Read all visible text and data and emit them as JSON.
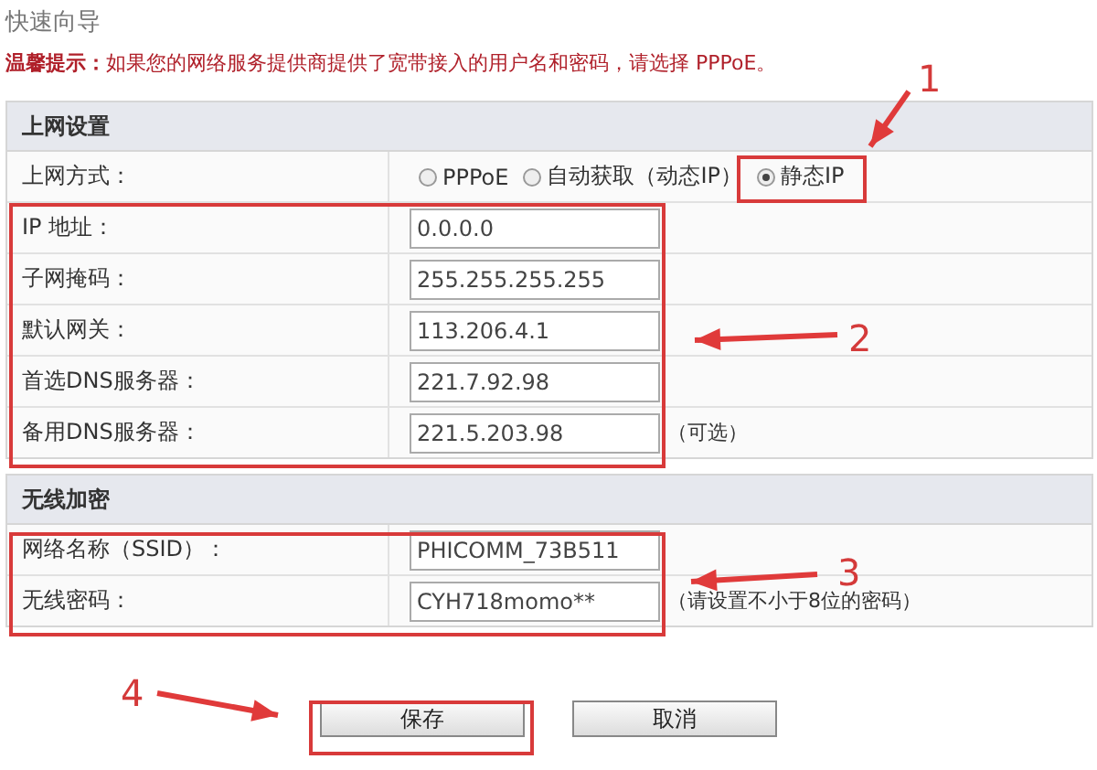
{
  "page_title": "快速向导",
  "tip": "**温馨提示：**如果您的网络服务提供商提供了宽带接入的用户名和密码，请选择 PPPoE。",
  "internet_section": {
    "heading": "上网设置",
    "mode_label": "上网方式：",
    "modes": [
      {
        "label": "PPPoE",
        "selected": false
      },
      {
        "label": "自动获取（动态IP）",
        "selected": false
      },
      {
        "label": "静态IP",
        "selected": true
      }
    ],
    "fields": [
      {
        "label": "IP 地址：",
        "value": "0.0.0.0"
      },
      {
        "label": "子网掩码：",
        "value": "255.255.255.255"
      },
      {
        "label": "默认网关：",
        "value": "113.206.4.1"
      },
      {
        "label": "首选DNS服务器：",
        "value": "221.7.92.98"
      },
      {
        "label": "备用DNS服务器：",
        "value": "221.5.203.98",
        "note": "（可选）"
      }
    ]
  },
  "wireless_section": {
    "heading": "无线加密",
    "fields": [
      {
        "label": "网络名称（SSID）：",
        "value": "PHICOMM_73B511"
      },
      {
        "label": "无线密码：",
        "value": "CYH718momo**",
        "note": "（请设置不小于8位的密码）"
      }
    ]
  },
  "buttons": [
    {
      "label": "保存"
    },
    {
      "label": "取消"
    }
  ],
  "annotations": [
    {
      "number": "1"
    },
    {
      "number": "2"
    },
    {
      "number": "3"
    },
    {
      "number": "4"
    }
  ]
}
